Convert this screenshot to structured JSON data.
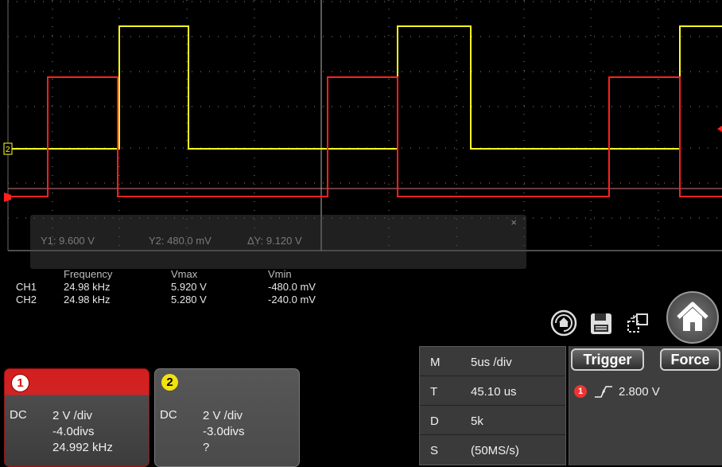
{
  "colors": {
    "ch1": "#ff2020",
    "ch2": "#ffff20",
    "grid": "#8a8a8a",
    "background": "#000000"
  },
  "cursor": {
    "y1": "Y1: 9.600 V",
    "y2": "Y2: 480.0 mV",
    "dy": "ΔY: 9.120 V",
    "close_icon": "×"
  },
  "measurements": {
    "headers": [
      "",
      "Frequency",
      "Vmax",
      "Vmin"
    ],
    "rows": [
      {
        "ch": "CH1",
        "frequency": "24.98 kHz",
        "vmax": "5.920 V",
        "vmin": "-480.0 mV"
      },
      {
        "ch": "CH2",
        "frequency": "24.98 kHz",
        "vmax": "5.280 V",
        "vmin": "-240.0 mV"
      }
    ]
  },
  "channel_markers": {
    "ch2": "2"
  },
  "channels": [
    {
      "badge": "1",
      "coupling": "DC",
      "scale": "2 V /div",
      "offset": "-4.0divs",
      "freq": "24.992 kHz"
    },
    {
      "badge": "2",
      "coupling": "DC",
      "scale": "2 V /div",
      "offset": "-3.0divs",
      "freq": "?"
    }
  ],
  "timebase": [
    {
      "key": "M",
      "value": "5us /div"
    },
    {
      "key": "T",
      "value": "45.10 us"
    },
    {
      "key": "D",
      "value": "5k"
    },
    {
      "key": "S",
      "value": "(50MS/s)"
    }
  ],
  "trigger": {
    "trigger_label": "Trigger",
    "force_label": "Force",
    "source": "1",
    "level": "2.800 V"
  },
  "icons": [
    "auto-set-icon",
    "save-icon",
    "window-icon",
    "home-icon"
  ]
}
